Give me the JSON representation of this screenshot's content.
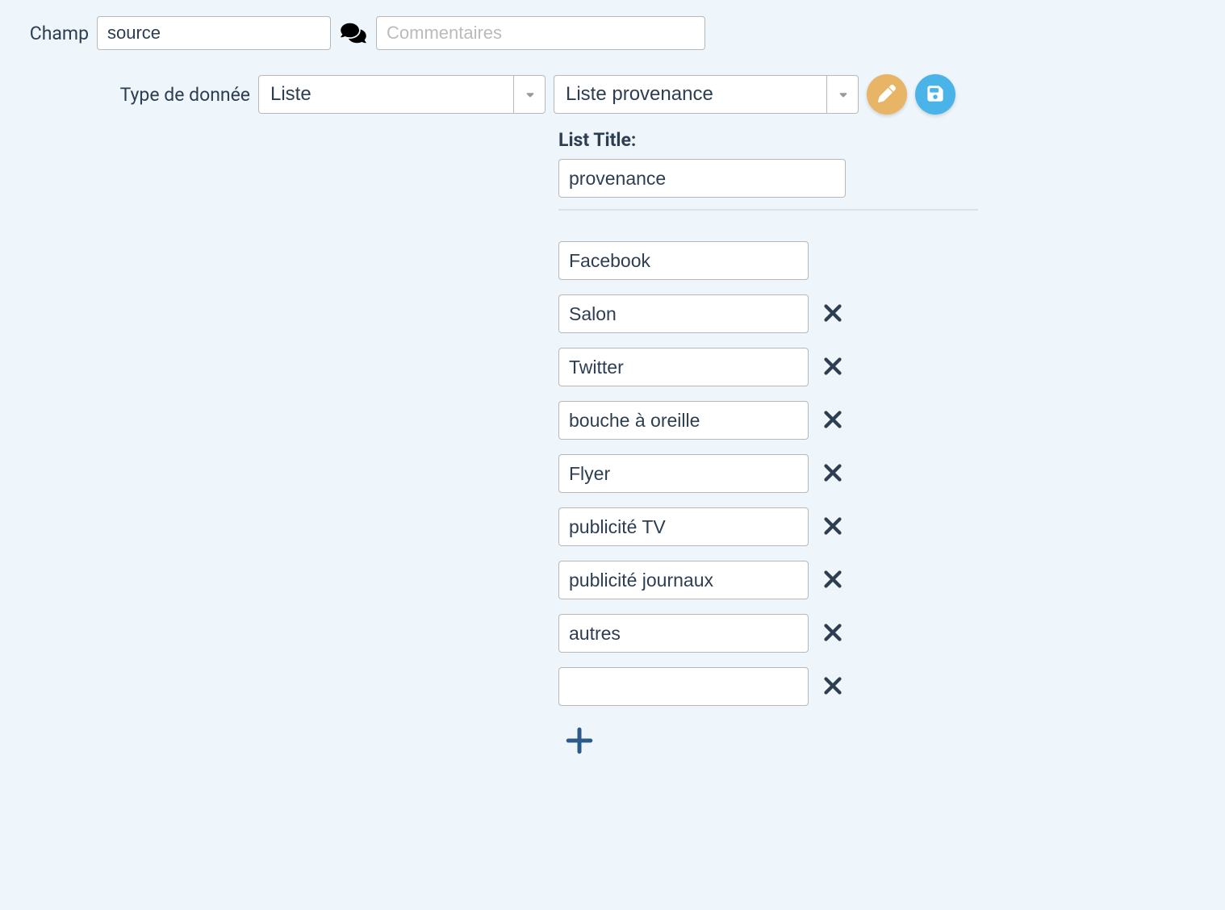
{
  "row1": {
    "champ_label": "Champ",
    "champ_value": "source",
    "comments_placeholder": "Commentaires",
    "comments_value": ""
  },
  "row2": {
    "type_label": "Type de donnée",
    "type_value": "Liste",
    "list_value": "Liste provenance"
  },
  "list_section": {
    "title_label": "List Title:",
    "title_value": "provenance",
    "items": [
      {
        "value": "Facebook",
        "deletable": false
      },
      {
        "value": "Salon",
        "deletable": true
      },
      {
        "value": "Twitter",
        "deletable": true
      },
      {
        "value": "bouche à oreille",
        "deletable": true
      },
      {
        "value": "Flyer",
        "deletable": true
      },
      {
        "value": "publicité TV",
        "deletable": true
      },
      {
        "value": "publicité journaux",
        "deletable": true
      },
      {
        "value": "autres",
        "deletable": true
      },
      {
        "value": "",
        "deletable": true
      }
    ]
  }
}
